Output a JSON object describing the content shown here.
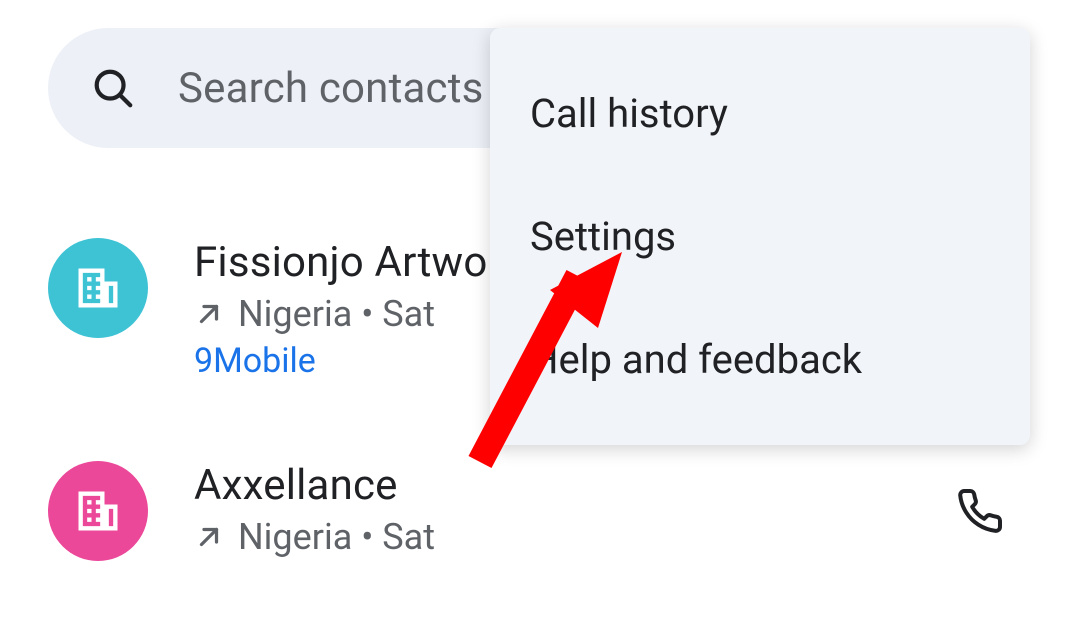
{
  "search": {
    "placeholder": "Search contacts and places"
  },
  "calls": [
    {
      "name": "Fissionjo Artworld",
      "meta": "Nigeria • Sat",
      "carrier": "9Mobile",
      "avatarColor": "teal"
    },
    {
      "name": "Axxellance",
      "meta": "Nigeria • Sat",
      "carrier": "",
      "avatarColor": "pink"
    }
  ],
  "menu": {
    "item1": "Call history",
    "item2": "Settings",
    "item3": "Help and feedback"
  }
}
